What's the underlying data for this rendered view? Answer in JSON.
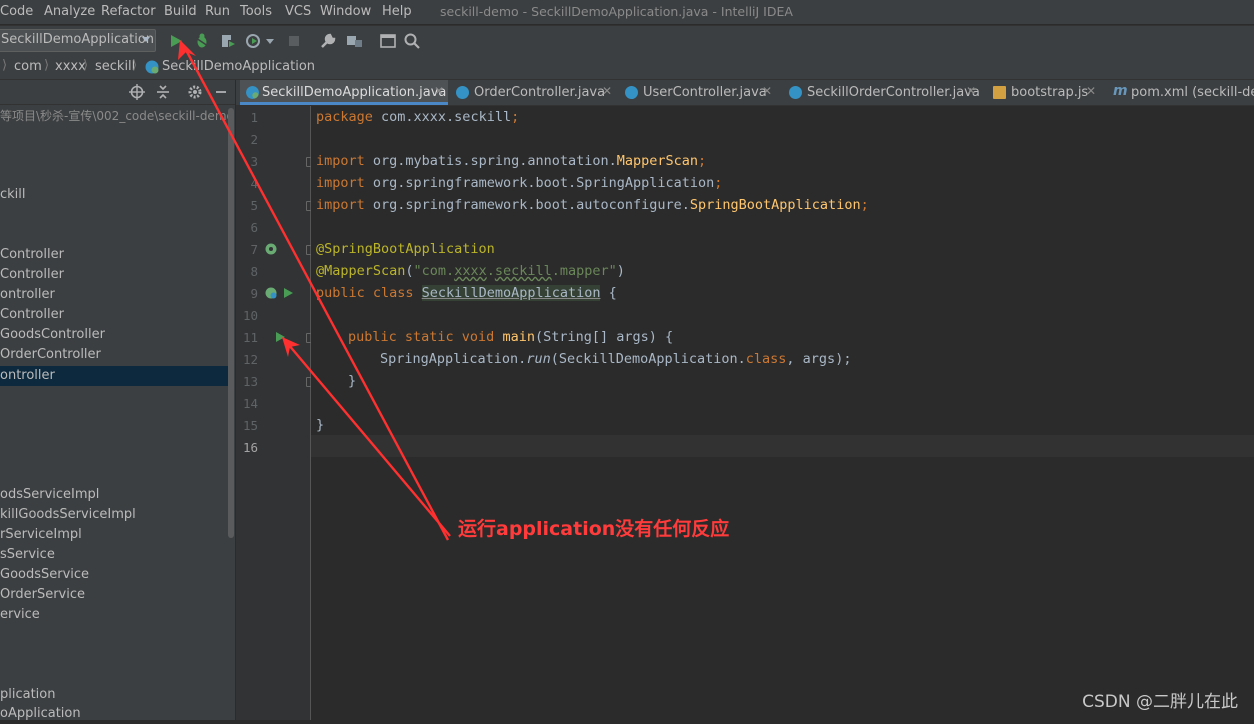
{
  "window": {
    "title": "seckill-demo - SeckillDemoApplication.java - IntelliJ IDEA"
  },
  "menu": [
    "Code",
    "Analyze",
    "Refactor",
    "Build",
    "Run",
    "Tools",
    "VCS",
    "Window",
    "Help"
  ],
  "toolbar": {
    "run_config": "SeckillDemoApplication"
  },
  "breadcrumb": [
    "com",
    "xxxx",
    "seckill",
    "SeckillDemoApplication"
  ],
  "project": {
    "path": "等项目\\秒杀-宣传\\002_code\\seckill-demo",
    "items": [
      "ckill",
      "Controller",
      "Controller",
      "ontroller",
      "Controller",
      "GoodsController",
      "OrderController",
      "ontroller",
      "odsServiceImpl",
      "killGoodsServiceImpl",
      "rServiceImpl",
      "sService",
      "GoodsService",
      "OrderService",
      "ervice",
      "plication",
      "oApplication"
    ]
  },
  "tabs": [
    {
      "label": "SeckillDemoApplication.java",
      "icon": "spring-class-icon",
      "active": true
    },
    {
      "label": "OrderController.java",
      "icon": "class-icon"
    },
    {
      "label": "UserController.java",
      "icon": "class-icon"
    },
    {
      "label": "SeckillOrderController.java",
      "icon": "class-icon"
    },
    {
      "label": "bootstrap.js",
      "icon": "js-file-icon"
    },
    {
      "label": "pom.xml (seckill-dem",
      "icon": "maven-icon"
    }
  ],
  "editor": {
    "line_numbers": [
      "1",
      "2",
      "3",
      "4",
      "5",
      "6",
      "7",
      "8",
      "9",
      "10",
      "11",
      "12",
      "13",
      "14",
      "15",
      "16"
    ],
    "current_line": "16",
    "code": {
      "l1_kw": "package",
      "l1_rest": " com.xxxx.seckill",
      "l1_semi": ";",
      "l3_kw": "import",
      "l3_pkg": " org.mybatis.spring.annotation.",
      "l3_cls": "MapperScan",
      "l4_pkg": " org.springframework.boot.SpringApplication",
      "l5_pkg": " org.springframework.boot.autoconfigure.",
      "l5_cls": "SpringBootApplication",
      "semi": ";",
      "l7": "@SpringBootApplication",
      "l8_ann": "@MapperScan",
      "l8_open": "(",
      "l8_str_a": "\"com.",
      "l8_str_b": "xxxx",
      "l8_str_c": ".",
      "l8_str_d": "seckill",
      "l8_str_e": ".mapper\"",
      "l8_close": ")",
      "l9_kw": "public class ",
      "l9_cls": "SeckillDemoApplication",
      "l9_brace": " {",
      "l11_kw": "public static void ",
      "l11_fn": "main",
      "l11_rest": "(String[] args) {",
      "l12_a": "SpringApplication.",
      "l12_fn": "run",
      "l12_b": "(SeckillDemoApplication.",
      "l12_kw": "class",
      "l12_c": ", args);",
      "l13": "}",
      "l15": "}"
    }
  },
  "annotation": {
    "text": "运行application没有任何反应",
    "color": "#ff3b3b"
  },
  "watermark": "CSDN @二胖儿在此"
}
